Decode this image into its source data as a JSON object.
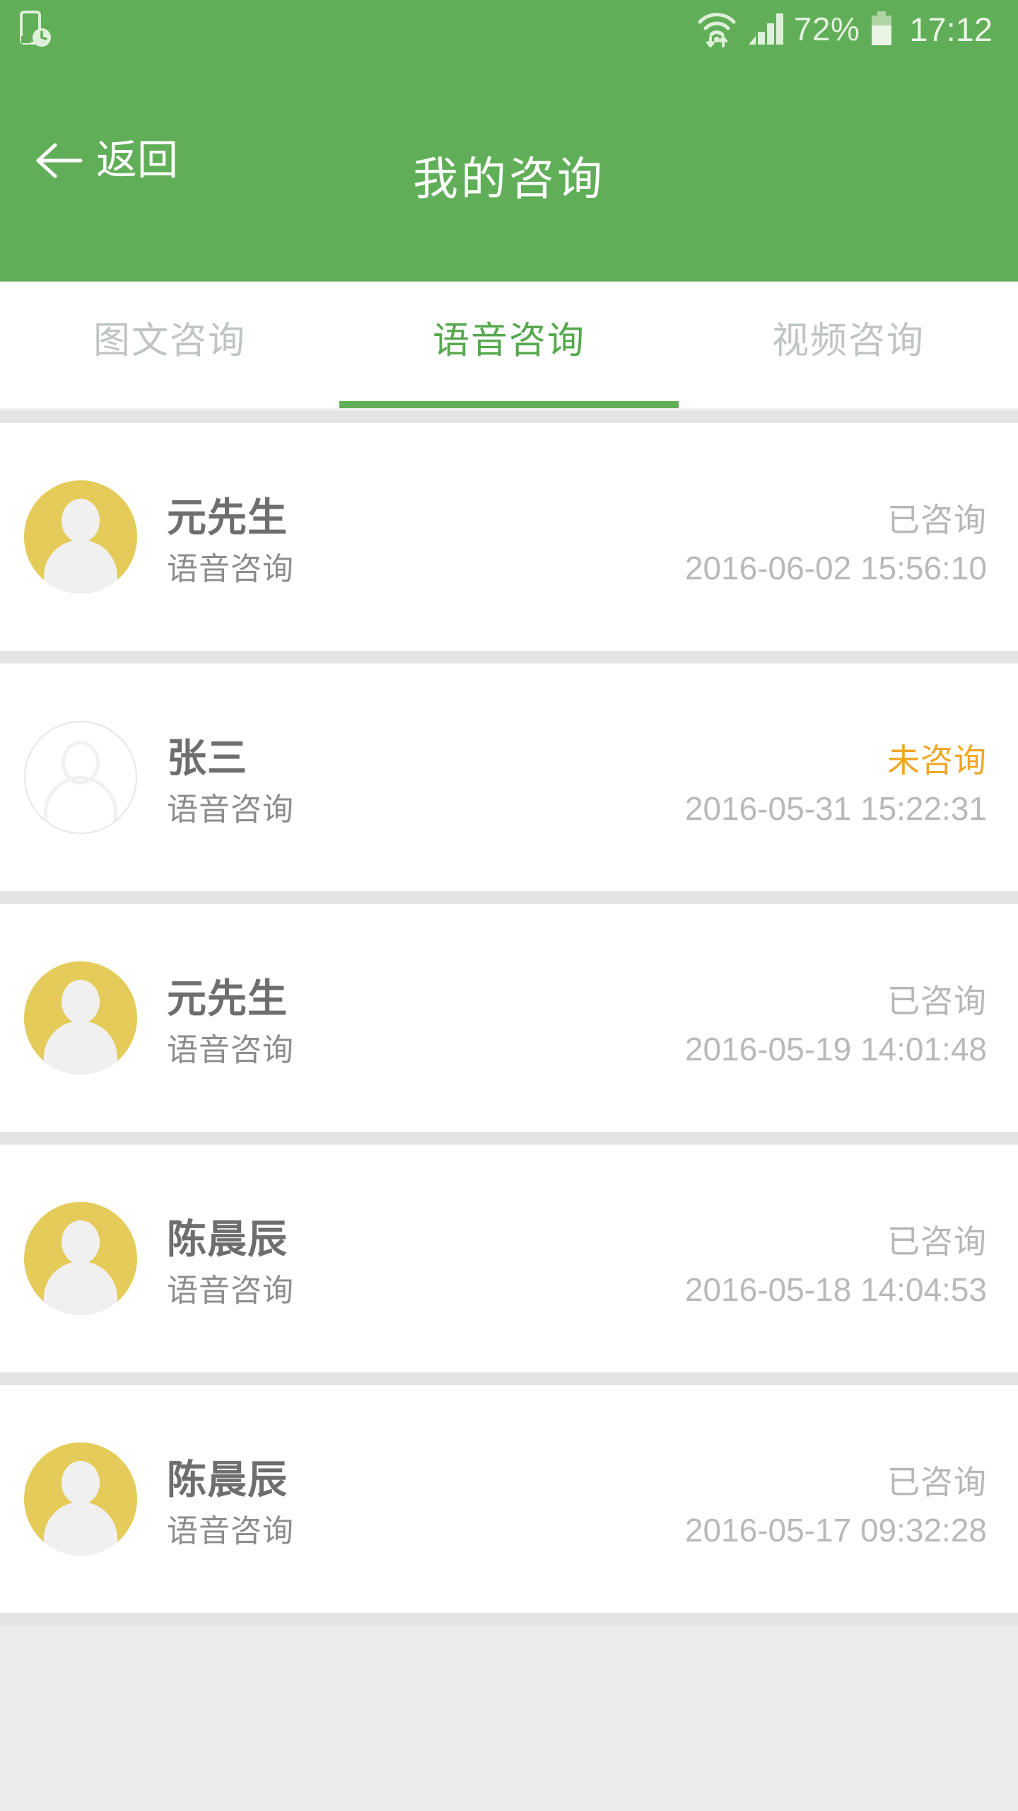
{
  "statusbar": {
    "icons": [
      "phone-clock-icon",
      "wifi-icon",
      "signal-icon",
      "battery-icon"
    ],
    "battery_percent": "72%",
    "clock": "17:12"
  },
  "appbar": {
    "back_label": "返回",
    "title": "我的咨询",
    "background": "#61ae58"
  },
  "tabs": [
    {
      "label": "图文咨询",
      "active": false
    },
    {
      "label": "语音咨询",
      "active": true
    },
    {
      "label": "视频咨询",
      "active": false
    }
  ],
  "colors": {
    "brand_green": "#61ae58",
    "active_tab_green": "#55a84d",
    "pending_orange": "#f0a728",
    "avatar_yellow": "#e5cb59",
    "separator_gray": "#e4e4e4",
    "page_background": "#ebebeb"
  },
  "list": [
    {
      "name": "元先生",
      "status": "已咨询",
      "status_state": "done",
      "kind": "语音咨询",
      "time": "2016-06-02 15:56:10",
      "avatar": "filled"
    },
    {
      "name": "张三",
      "status": "未咨询",
      "status_state": "pending",
      "kind": "语音咨询",
      "time": "2016-05-31 15:22:31",
      "avatar": "empty"
    },
    {
      "name": "元先生",
      "status": "已咨询",
      "status_state": "done",
      "kind": "语音咨询",
      "time": "2016-05-19 14:01:48",
      "avatar": "filled"
    },
    {
      "name": "陈晨辰",
      "status": "已咨询",
      "status_state": "done",
      "kind": "语音咨询",
      "time": "2016-05-18 14:04:53",
      "avatar": "filled"
    },
    {
      "name": "陈晨辰",
      "status": "已咨询",
      "status_state": "done",
      "kind": "语音咨询",
      "time": "2016-05-17 09:32:28",
      "avatar": "filled"
    }
  ]
}
